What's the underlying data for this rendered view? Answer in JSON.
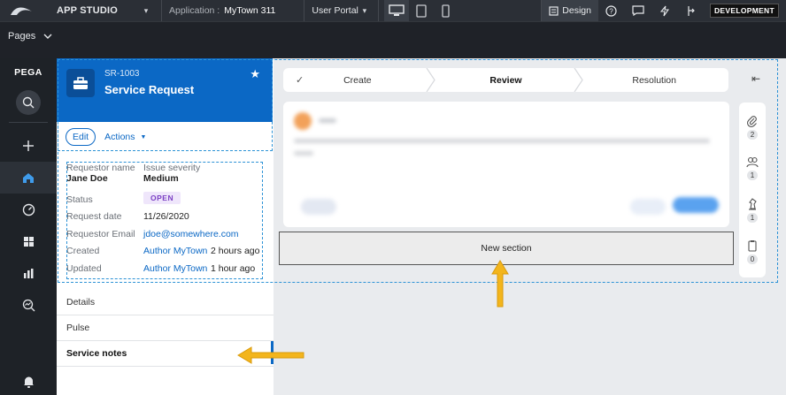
{
  "topbar": {
    "app_name": "APP STUDIO",
    "application_label": "Application :",
    "application_value": "MyTown 311",
    "portal": "User Portal",
    "design_label": "Design",
    "env_badge": "DEVELOPMENT"
  },
  "pagesbar": {
    "label": "Pages"
  },
  "leftnav": {
    "brand": "PEGA"
  },
  "case": {
    "id": "SR-1003",
    "title": "Service Request",
    "edit_label": "Edit",
    "actions_label": "Actions"
  },
  "details": {
    "requestor_name_label": "Requestor name",
    "requestor_name": "Jane Doe",
    "issue_severity_label": "Issue severity",
    "issue_severity": "Medium",
    "status_label": "Status",
    "status": "OPEN",
    "request_date_label": "Request date",
    "request_date": "11/26/2020",
    "requestor_email_label": "Requestor Email",
    "requestor_email": "jdoe@somewhere.com",
    "created_label": "Created",
    "created_by": "Author MyTown",
    "created_ago": "2 hours ago",
    "updated_label": "Updated",
    "updated_by": "Author MyTown",
    "updated_ago": "1 hour ago"
  },
  "tabs": [
    "Details",
    "Pulse",
    "Service notes"
  ],
  "stages": [
    "Create",
    "Review",
    "Resolution"
  ],
  "new_section_label": "New section",
  "utilities": {
    "attachments": "2",
    "followers": "1",
    "stakeholders": "1",
    "tasks": "0"
  },
  "colors": {
    "accent": "#0b68c5",
    "highlight_arrow": "#f3b51c",
    "selection": "#2c92d6"
  }
}
